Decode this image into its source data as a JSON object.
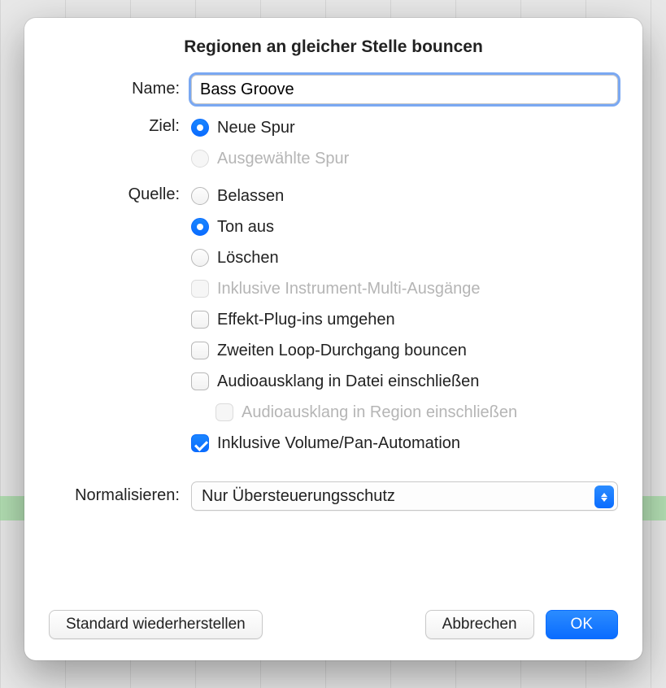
{
  "dialog": {
    "title": "Regionen an gleicher Stelle bouncen",
    "name": {
      "label": "Name:",
      "value": "Bass Groove"
    },
    "ziel": {
      "label": "Ziel:",
      "options": {
        "neue_spur": "Neue Spur",
        "ausgewaehlte_spur": "Ausgewählte Spur"
      }
    },
    "quelle": {
      "label": "Quelle:",
      "options": {
        "belassen": "Belassen",
        "ton_aus": "Ton aus",
        "loeschen": "Löschen"
      },
      "checks": {
        "multi_ausgaenge": "Inklusive Instrument-Multi-Ausgänge",
        "bypass_fx": "Effekt-Plug-ins umgehen",
        "second_loop": "Zweiten Loop-Durchgang bouncen",
        "tail_file": "Audioausklang in Datei einschließen",
        "tail_region": "Audioausklang in Region einschließen",
        "vol_pan": "Inklusive Volume/Pan-Automation"
      }
    },
    "normalize": {
      "label": "Normalisieren:",
      "value": "Nur Übersteuerungsschutz"
    },
    "buttons": {
      "restore": "Standard wiederherstellen",
      "cancel": "Abbrechen",
      "ok": "OK"
    }
  }
}
